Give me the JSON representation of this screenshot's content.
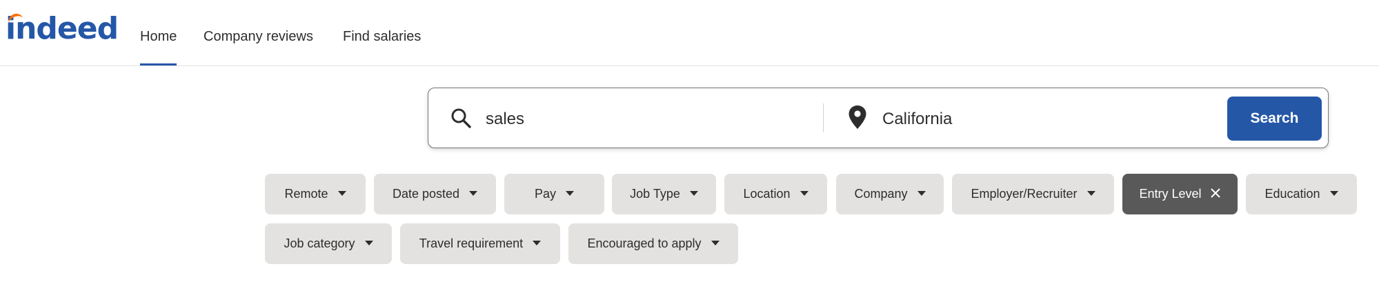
{
  "logo": {
    "text": "indeed",
    "brand_color": "#2557a7",
    "accent_color": "#ff6f00"
  },
  "nav": [
    {
      "label": "Home",
      "active": true
    },
    {
      "label": "Company reviews",
      "active": false
    },
    {
      "label": "Find salaries",
      "active": false
    }
  ],
  "search": {
    "what_value": "sales",
    "where_value": "California",
    "button_label": "Search",
    "what_icon": "search-icon",
    "where_icon": "location-pin-icon"
  },
  "filters": {
    "row1": [
      {
        "label": "Remote",
        "active": false
      },
      {
        "label": "Date posted",
        "active": false
      },
      {
        "label": "Pay",
        "active": false
      },
      {
        "label": "Job Type",
        "active": false
      },
      {
        "label": "Location",
        "active": false
      },
      {
        "label": "Company",
        "active": false
      },
      {
        "label": "Employer/Recruiter",
        "active": false
      },
      {
        "label": "Entry Level",
        "active": true
      },
      {
        "label": "Education",
        "active": false
      }
    ],
    "row2": [
      {
        "label": "Job category",
        "active": false
      },
      {
        "label": "Travel requirement",
        "active": false
      },
      {
        "label": "Encouraged to apply",
        "active": false
      }
    ]
  }
}
